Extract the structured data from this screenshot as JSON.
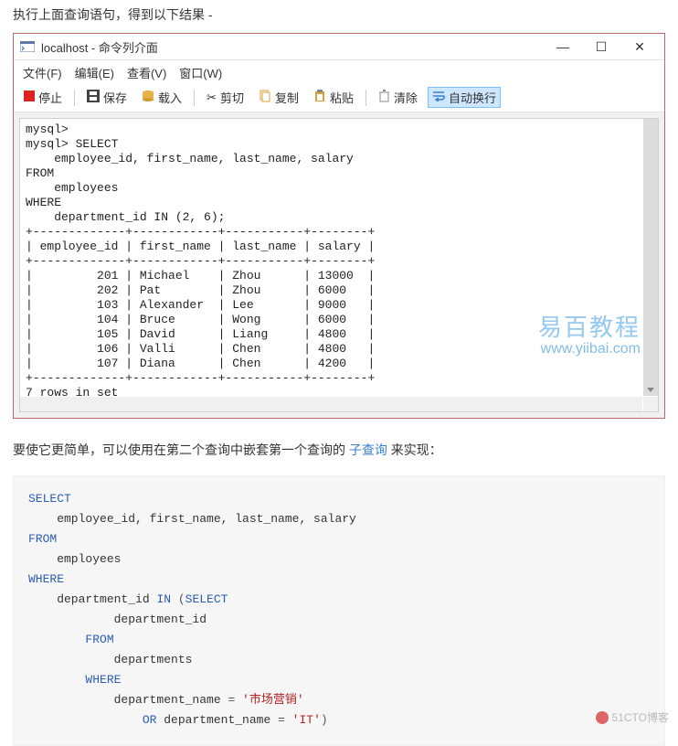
{
  "intro_text": "执行上面查询语句，得到以下结果 -",
  "window": {
    "title": "localhost - 命令列介面",
    "controls": {
      "min": "—",
      "max": "☐",
      "close": "✕"
    }
  },
  "menubar": {
    "file": "文件(F)",
    "edit": "编辑(E)",
    "view": "查看(V)",
    "window": "窗口(W)"
  },
  "toolbar": {
    "stop": "停止",
    "save": "保存",
    "load": "载入",
    "cut": "剪切",
    "copy": "复制",
    "paste": "粘贴",
    "clear": "清除",
    "wrap": "自动换行"
  },
  "console_output": "mysql>\nmysql> SELECT \n    employee_id, first_name, last_name, salary\nFROM\n    employees\nWHERE\n    department_id IN (2, 6);\n+-------------+------------+-----------+--------+\n| employee_id | first_name | last_name | salary |\n+-------------+------------+-----------+--------+\n|         201 | Michael    | Zhou      | 13000  |\n|         202 | Pat        | Zhou      | 6000   |\n|         103 | Alexander  | Lee       | 9000   |\n|         104 | Bruce      | Wong      | 6000   |\n|         105 | David      | Liang     | 4800   |\n|         106 | Valli      | Chen      | 4800   |\n|         107 | Diana      | Chen      | 4200   |\n+-------------+------------+-----------+--------+\n7 rows in set",
  "watermark": {
    "line1": "易百教程",
    "line2": "www.yiibai.com"
  },
  "para2": {
    "before": "要使它更简单，可以使用在第二个查询中嵌套第一个查询的 ",
    "link": "子查询",
    "after": " 来实现："
  },
  "sql": {
    "l1_kw": "SELECT",
    "l2": "    employee_id, first_name, last_name, salary",
    "l3_kw": "FROM",
    "l4": "    employees",
    "l5_kw": "WHERE",
    "l6_a": "    department_id ",
    "l6_in": "IN",
    "l6_paren": " (",
    "l6_sel": "SELECT ",
    "l7": "            department_id",
    "l8_kw": "        FROM",
    "l9": "            departments",
    "l10_kw": "        WHERE",
    "l11_a": "            department_name ",
    "l11_eq": "=",
    "l11_str": " '市场营销'",
    "l12_or": "                OR",
    "l12_b": " department_name ",
    "l12_eq": "=",
    "l12_str": " 'IT'",
    "l12_close": ")"
  },
  "footer_watermark": "51CTO博客"
}
